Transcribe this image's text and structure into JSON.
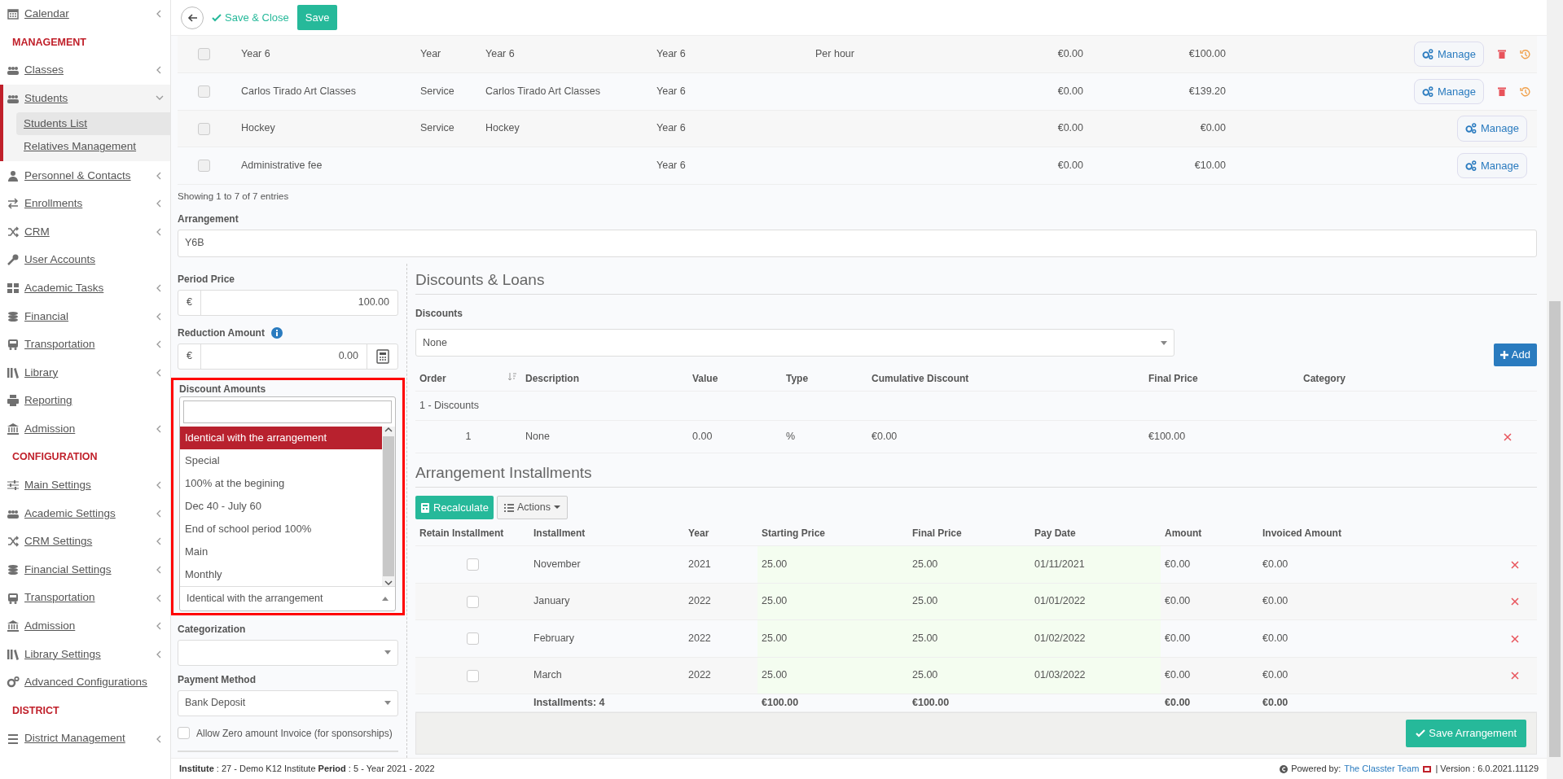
{
  "sidebar": {
    "items": [
      {
        "kind": "item",
        "label": "Calendar",
        "submenu": true,
        "selected": false
      },
      {
        "kind": "heading",
        "label": "MANAGEMENT"
      },
      {
        "kind": "item",
        "label": "Classes",
        "submenu": true,
        "selected": false
      },
      {
        "kind": "item",
        "label": "Students",
        "submenu": true,
        "selected": true,
        "expanded": true,
        "children": [
          {
            "label": "Students List",
            "selected": true
          },
          {
            "label": "Relatives Management",
            "selected": false
          }
        ]
      },
      {
        "kind": "item",
        "label": "Personnel & Contacts",
        "submenu": true,
        "selected": false
      },
      {
        "kind": "item",
        "label": "Enrollments",
        "submenu": true,
        "selected": false
      },
      {
        "kind": "item",
        "label": "CRM",
        "submenu": true,
        "selected": false
      },
      {
        "kind": "item",
        "label": "User Accounts",
        "submenu": false,
        "selected": false
      },
      {
        "kind": "item",
        "label": "Academic Tasks",
        "submenu": true,
        "selected": false
      },
      {
        "kind": "item",
        "label": "Financial",
        "submenu": true,
        "selected": false
      },
      {
        "kind": "item",
        "label": "Transportation",
        "submenu": true,
        "selected": false
      },
      {
        "kind": "item",
        "label": "Library",
        "submenu": true,
        "selected": false
      },
      {
        "kind": "item",
        "label": "Reporting",
        "submenu": false,
        "selected": false
      },
      {
        "kind": "item",
        "label": "Admission",
        "submenu": true,
        "selected": false
      },
      {
        "kind": "heading",
        "label": "CONFIGURATION"
      },
      {
        "kind": "item",
        "label": "Main Settings",
        "submenu": true,
        "selected": false
      },
      {
        "kind": "item",
        "label": "Academic Settings",
        "submenu": true,
        "selected": false
      },
      {
        "kind": "item",
        "label": "CRM Settings",
        "submenu": true,
        "selected": false
      },
      {
        "kind": "item",
        "label": "Financial Settings",
        "submenu": true,
        "selected": false
      },
      {
        "kind": "item",
        "label": "Transportation",
        "submenu": true,
        "selected": false
      },
      {
        "kind": "item",
        "label": "Admission",
        "submenu": true,
        "selected": false
      },
      {
        "kind": "item",
        "label": "Library Settings",
        "submenu": true,
        "selected": false
      },
      {
        "kind": "item",
        "label": "Advanced Configurations",
        "submenu": false,
        "selected": false
      },
      {
        "kind": "heading",
        "label": "DISTRICT"
      },
      {
        "kind": "item",
        "label": "District Management",
        "submenu": true,
        "selected": false
      }
    ]
  },
  "toolbar": {
    "save_close": "Save & Close",
    "save": "Save"
  },
  "items_table": {
    "rows": [
      {
        "checked": false,
        "removable": true,
        "column_2": "Year 6",
        "column_3": "Year",
        "column_4": "Year 6",
        "column_5": "Year 6",
        "column_6": "Per hour",
        "column_7": "€0.00",
        "column_8": "€100.00",
        "action": "Manage"
      },
      {
        "checked": false,
        "removable": true,
        "column_2": "Carlos Tirado Art Classes",
        "column_3": "Service",
        "column_4": "Carlos Tirado Art Classes",
        "column_5": "Year 6",
        "column_7": "€0.00",
        "column_8": "€139.20",
        "action": "Manage"
      },
      {
        "checked": false,
        "removable": false,
        "column_2": "Hockey",
        "column_3": "Service",
        "column_4": "Hockey",
        "column_5": "Year 6",
        "column_7": "€0.00",
        "column_8": "€0.00",
        "action": "Manage"
      },
      {
        "checked": false,
        "removable": false,
        "column_2": "Administrative fee",
        "column_5": "Year 6",
        "column_7": "€0.00",
        "column_8": "€10.00",
        "action": "Manage"
      }
    ],
    "info": "Showing 1 to 7 of 7 entries"
  },
  "arrangement": {
    "label": "Arrangement",
    "value": "Y6B"
  },
  "form": {
    "period_price": {
      "label": "Period Price",
      "currency": "€",
      "value": "100.00"
    },
    "reduction_amount": {
      "label": "Reduction Amount",
      "currency": "€",
      "value": "0.00"
    },
    "discount_amounts": {
      "label": "Discount Amounts",
      "value": "Identical with the arrangement",
      "expanded": true,
      "options": [
        {
          "label": "Identical with the arrangement",
          "selected": true
        },
        {
          "label": "Special",
          "selected": false
        },
        {
          "label": "100% at the begining",
          "selected": false
        },
        {
          "label": "Dec 40 - July 60",
          "selected": false
        },
        {
          "label": "End of school period 100%",
          "selected": false
        },
        {
          "label": "Main",
          "selected": false
        },
        {
          "label": "Monthly",
          "selected": false
        }
      ]
    },
    "categorization": {
      "label": "Categorization"
    },
    "payment_method": {
      "label": "Payment Method",
      "value": "Bank Deposit"
    },
    "allow_zero": {
      "label": "Allow Zero amount Invoice (for sponsorships)",
      "checked": false
    }
  },
  "discounts": {
    "title": "Discounts & Loans",
    "label": "Discounts",
    "value": "None",
    "add": "Add",
    "columns": [
      "Order",
      "Description",
      "Value",
      "Type",
      "Cumulative Discount",
      "Final Price",
      "Category"
    ],
    "group": "1 - Discounts",
    "rows": [
      {
        "order": "1",
        "description": "None",
        "value": "0.00",
        "type": "%",
        "cumulative_discount": "€0.00",
        "final_price": "€100.00"
      }
    ]
  },
  "installments": {
    "title": "Arrangement Installments",
    "recalculate": "Recalculate",
    "actions": "Actions",
    "columns": [
      "Retain Installment",
      "Installment",
      "Year",
      "Starting Price",
      "Final Price",
      "Pay Date",
      "Amount",
      "Invoiced Amount"
    ],
    "rows": [
      {
        "retain": false,
        "installment": "November",
        "year": "2021",
        "starting_price": "25.00",
        "final_price": "25.00",
        "pay_date": "01/11/2021",
        "amount": "€0.00",
        "invoiced_amount": "€0.00"
      },
      {
        "retain": false,
        "installment": "January",
        "year": "2022",
        "starting_price": "25.00",
        "final_price": "25.00",
        "pay_date": "01/01/2022",
        "amount": "€0.00",
        "invoiced_amount": "€0.00"
      },
      {
        "retain": false,
        "installment": "February",
        "year": "2022",
        "starting_price": "25.00",
        "final_price": "25.00",
        "pay_date": "01/02/2022",
        "amount": "€0.00",
        "invoiced_amount": "€0.00"
      },
      {
        "retain": false,
        "installment": "March",
        "year": "2022",
        "starting_price": "25.00",
        "final_price": "25.00",
        "pay_date": "01/03/2022",
        "amount": "€0.00",
        "invoiced_amount": "€0.00"
      }
    ],
    "totals": {
      "installment": "Installments: 4",
      "starting_price": "€100.00",
      "final_price": "€100.00",
      "amount": "€0.00",
      "invoiced_amount": "€0.00"
    },
    "save": "Save Arrangement"
  },
  "status_bar": {
    "info": "**Institute** : 27 - Demo K12 Institute **Period** : 5 - Year 2021 - 2022",
    "powered": "Powered by:",
    "team": "The Classter Team",
    "version": "| Version : 6.0.2021.11129"
  }
}
